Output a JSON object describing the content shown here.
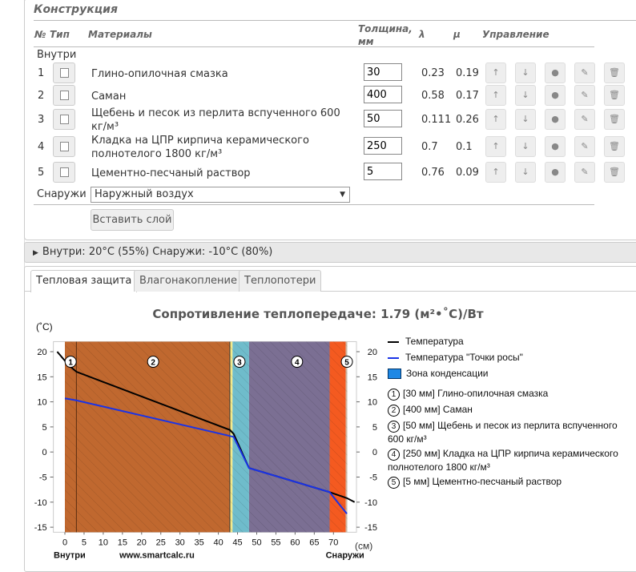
{
  "construction": {
    "title": "Конструкция",
    "headers": {
      "num": "№",
      "type": "Тип",
      "materials": "Материалы",
      "thickness": "Толщина,",
      "thickness_unit": "мм",
      "lambda": "λ",
      "mu": "μ",
      "controls": "Управление"
    },
    "inside_label": "Внутри",
    "outside_label": "Снаружи",
    "outside_value": "Наружный воздух",
    "insert_button": "Вставить слой",
    "layers": [
      {
        "n": "1",
        "name": "Глино-опилочная смазка",
        "thickness": "30",
        "lambda": "0.23",
        "mu": "0.19"
      },
      {
        "n": "2",
        "name": "Саман",
        "thickness": "400",
        "lambda": "0.58",
        "mu": "0.17"
      },
      {
        "n": "3",
        "name": "Щебень и песок из перлита вспученного 600 кг/м³",
        "thickness": "50",
        "lambda": "0.111",
        "mu": "0.26"
      },
      {
        "n": "4",
        "name": "Кладка на ЦПР кирпича керамического полнотелого 1800 кг/м³",
        "thickness": "250",
        "lambda": "0.7",
        "mu": "0.1"
      },
      {
        "n": "5",
        "name": "Цементно-песчаный раствор",
        "thickness": "5",
        "lambda": "0.76",
        "mu": "0.09"
      }
    ]
  },
  "conditions": "Внутри: 20°C (55%) Снаружи: -10°C (80%)",
  "tabs": [
    "Тепловая защита",
    "Влагонакопление",
    "Теплопотери"
  ],
  "chart_data": {
    "type": "line",
    "title": "Сопротивление теплопередаче: 1.79 (м²•˚C)/Вт",
    "ylabel": "(˚C)",
    "xlabel": "(см)",
    "left_label": "Внутри",
    "right_label": "Снаружи",
    "watermark": "www.smartcalc.ru",
    "xlim": [
      -3,
      76
    ],
    "ylim": [
      -16,
      22
    ],
    "xticks": [
      0,
      5,
      10,
      15,
      20,
      25,
      30,
      35,
      40,
      45,
      50,
      55,
      60,
      65,
      70
    ],
    "yticks": [
      20,
      15,
      10,
      5,
      0,
      -5,
      -10,
      -15
    ],
    "bands": [
      {
        "from": 0,
        "to": 43,
        "color": "#c0682f"
      },
      {
        "from": 43,
        "to": 43.7,
        "color": "#f3e98a"
      },
      {
        "from": 43.7,
        "to": 48,
        "color": "#6fbccb"
      },
      {
        "from": 48,
        "to": 69,
        "color": "#7b6f93"
      },
      {
        "from": 69,
        "to": 73.2,
        "color": "#f45a20"
      },
      {
        "from": 73.2,
        "to": 73.6,
        "color": "#cbb8a4"
      }
    ],
    "layer_markers": [
      {
        "label": "1",
        "x": 1.5
      },
      {
        "label": "2",
        "x": 23
      },
      {
        "label": "3",
        "x": 45.5
      },
      {
        "label": "4",
        "x": 60.5
      },
      {
        "label": "5",
        "x": 73.5
      }
    ],
    "series": [
      {
        "name": "Температура",
        "color": "#000000",
        "points": [
          [
            -2,
            20
          ],
          [
            1,
            17.3
          ],
          [
            3,
            16
          ],
          [
            43,
            4.4
          ],
          [
            44,
            3.6
          ],
          [
            48,
            -3.2
          ],
          [
            69,
            -8
          ],
          [
            73.5,
            -9.2
          ],
          [
            75.5,
            -10
          ]
        ]
      },
      {
        "name": "Температура \"Точки росы\"",
        "color": "#1a33e6",
        "points": [
          [
            0,
            10.7
          ],
          [
            3,
            10.3
          ],
          [
            43,
            3.2
          ],
          [
            44,
            3
          ],
          [
            48,
            -3.2
          ],
          [
            69,
            -8
          ],
          [
            70,
            -9
          ],
          [
            73.5,
            -12.3
          ]
        ]
      }
    ],
    "condensation_label": "Зона конденсации",
    "condensation_color": "#1e88e5",
    "legend_layers": [
      "[30 мм] Глино-опилочная смазка",
      "[400 мм] Саман",
      "[50 мм] Щебень и песок из перлита вспученного 600 кг/м³",
      "[250 мм] Кладка на ЦПР кирпича керамического полнотелого 1800 кг/м³",
      "[5 мм] Цементно-песчаный раствор"
    ]
  }
}
